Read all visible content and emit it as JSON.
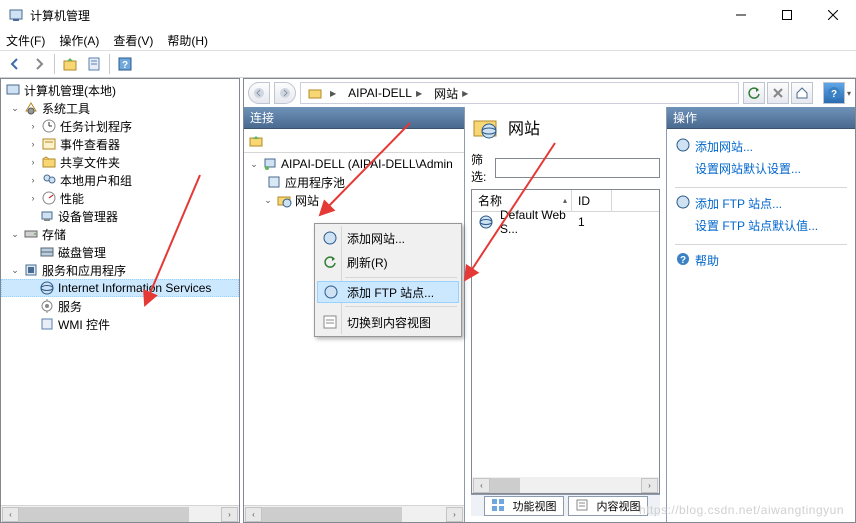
{
  "window": {
    "title": "计算机管理"
  },
  "menu": {
    "file": "文件(F)",
    "action": "操作(A)",
    "view": "查看(V)",
    "help": "帮助(H)"
  },
  "left_tree": {
    "root": "计算机管理(本地)",
    "sys_tools": "系统工具",
    "task_sched": "任务计划程序",
    "event_viewer": "事件查看器",
    "shared_folders": "共享文件夹",
    "local_users": "本地用户和组",
    "performance": "性能",
    "device_mgr": "设备管理器",
    "storage": "存储",
    "disk_mgmt": "磁盘管理",
    "services_apps": "服务和应用程序",
    "iis": "Internet Information Services",
    "services": "服务",
    "wmi": "WMI 控件"
  },
  "breadcrumb": {
    "host": "AIPAI-DELL",
    "sites": "网站"
  },
  "conn": {
    "head": "连接",
    "server": "AIPAI-DELL (AIPAI-DELL\\Admin",
    "app_pools": "应用程序池",
    "sites": "网站"
  },
  "mid": {
    "title": "网站",
    "filter_label": "筛选:",
    "filter_value": "",
    "col_name": "名称",
    "col_id": "ID",
    "row_name": "Default Web S...",
    "row_id": "1",
    "tab_features": "功能视图",
    "tab_content": "内容视图"
  },
  "actions": {
    "head": "操作",
    "add_site": "添加网站...",
    "set_site_defaults": "设置网站默认设置...",
    "add_ftp": "添加 FTP 站点...",
    "set_ftp_defaults": "设置 FTP 站点默认值...",
    "help": "帮助"
  },
  "ctx": {
    "add_site": "添加网站...",
    "refresh": "刷新(R)",
    "add_ftp": "添加 FTP 站点...",
    "switch_view": "切换到内容视图"
  },
  "watermark": "https://blog.csdn.net/aiwangtingyun"
}
